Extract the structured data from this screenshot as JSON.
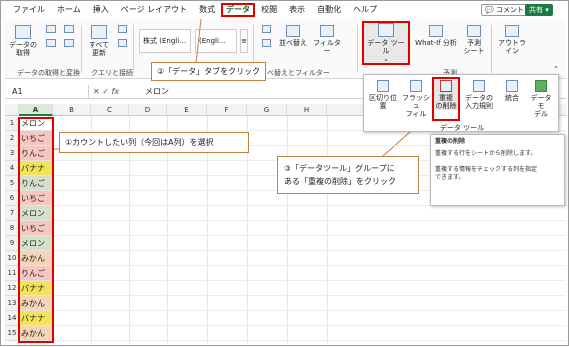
{
  "tabs": [
    "ファイル",
    "ホーム",
    "挿入",
    "ページ レイアウト",
    "数式",
    "データ",
    "校閲",
    "表示",
    "自動化",
    "ヘルプ"
  ],
  "active_tab_index": 5,
  "right_buttons": {
    "comment": "コメント",
    "share": "共有"
  },
  "ribbon": {
    "get_data": "データの\n取得",
    "refresh_all": "すべて\n更新",
    "stock": "株式 (Engli…",
    "currency": "(Engli…",
    "sort": "並べ替え",
    "filter": "フィルター",
    "data_tools": "データ ツール",
    "what_if": "What-If 分析",
    "forecast_sheet": "予測\nシート",
    "outline": "アウトラ\nイン",
    "group_get": "データの取得と変換",
    "group_query": "クエリと接続",
    "group_sort": "べ替えとフィルター",
    "group_forecast": "予測"
  },
  "subpanel": {
    "items": [
      "区切り位置",
      "フラッシュ\nフィル",
      "重複\nの削除",
      "データの\n入力規則",
      "統合",
      "データ モ\nデル"
    ],
    "label": "データ ツール"
  },
  "tooltip": {
    "title": "重複の削除",
    "line1": "重複する行をシートから削除します。",
    "line2": "重複する情報をチェックする列を指定\nできます。"
  },
  "formula_bar": {
    "name_box": "A1",
    "fx": "fx",
    "value": "メロン"
  },
  "columns": [
    "A",
    "B",
    "C",
    "D",
    "E",
    "F",
    "G",
    "H"
  ],
  "rows": [
    {
      "n": "1",
      "v": "メロン",
      "c": "#ffffff"
    },
    {
      "n": "2",
      "v": "いちご",
      "c": "#f6c6c0"
    },
    {
      "n": "3",
      "v": "りんご",
      "c": "#f6c6c0"
    },
    {
      "n": "4",
      "v": "バナナ",
      "c": "#f2e35a"
    },
    {
      "n": "5",
      "v": "りんご",
      "c": "#d5e0c8"
    },
    {
      "n": "6",
      "v": "いちご",
      "c": "#f6c6c0"
    },
    {
      "n": "7",
      "v": "メロン",
      "c": "#d5e0c8"
    },
    {
      "n": "8",
      "v": "いちご",
      "c": "#f6c6c0"
    },
    {
      "n": "9",
      "v": "メロン",
      "c": "#d5e0c8"
    },
    {
      "n": "10",
      "v": "みかん",
      "c": "#f3d6b8"
    },
    {
      "n": "11",
      "v": "りんご",
      "c": "#f6c6c0"
    },
    {
      "n": "12",
      "v": "バナナ",
      "c": "#f2e35a"
    },
    {
      "n": "13",
      "v": "みかん",
      "c": "#f3d6b8"
    },
    {
      "n": "14",
      "v": "バナナ",
      "c": "#f2e35a"
    },
    {
      "n": "15",
      "v": "みかん",
      "c": "#f3d6b8"
    }
  ],
  "callouts": {
    "step1": "①カウントしたい列（今回はA列）を選択",
    "step2": "②「データ」タブをクリック",
    "step3_line1": "③「データツール」グループに",
    "step3_line2": "ある「重複の削除」をクリック"
  },
  "colors": {
    "accent": "#e00000",
    "excel_green": "#1e7a45"
  }
}
